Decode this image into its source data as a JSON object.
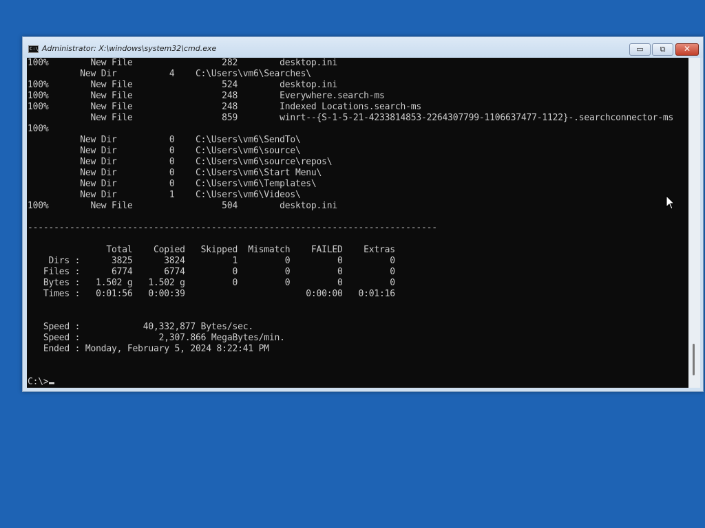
{
  "window": {
    "title": "Administrator: X:\\windows\\system32\\cmd.exe",
    "icon_label": "C:\\",
    "minimize_symbol": "▭",
    "restore_symbol": "⧉",
    "close_symbol": "✕"
  },
  "console": {
    "lines": [
      "100%        New File                 282        desktop.ini",
      "          New Dir          4    C:\\Users\\vm6\\Searches\\",
      "100%        New File                 524        desktop.ini",
      "100%        New File                 248        Everywhere.search-ms",
      "100%        New File                 248        Indexed Locations.search-ms",
      "            New File                 859        winrt--{S-1-5-21-4233814853-2264307799-1106637477-1122}-.searchconnector-ms",
      "100%",
      "          New Dir          0    C:\\Users\\vm6\\SendTo\\",
      "          New Dir          0    C:\\Users\\vm6\\source\\",
      "          New Dir          0    C:\\Users\\vm6\\source\\repos\\",
      "          New Dir          0    C:\\Users\\vm6\\Start Menu\\",
      "          New Dir          0    C:\\Users\\vm6\\Templates\\",
      "          New Dir          1    C:\\Users\\vm6\\Videos\\",
      "100%        New File                 504        desktop.ini",
      "",
      "------------------------------------------------------------------------------",
      "",
      "               Total    Copied   Skipped  Mismatch    FAILED    Extras",
      "    Dirs :      3825      3824         1         0         0         0",
      "   Files :      6774      6774         0         0         0         0",
      "   Bytes :   1.502 g   1.502 g         0         0         0         0",
      "   Times :   0:01:56   0:00:39                       0:00:00   0:01:16",
      "",
      "",
      "   Speed :            40,332,877 Bytes/sec.",
      "   Speed :               2,307.866 MegaBytes/min.",
      "   Ended : Monday, February 5, 2024 8:22:41 PM",
      "",
      ""
    ],
    "prompt": "C:\\>"
  }
}
